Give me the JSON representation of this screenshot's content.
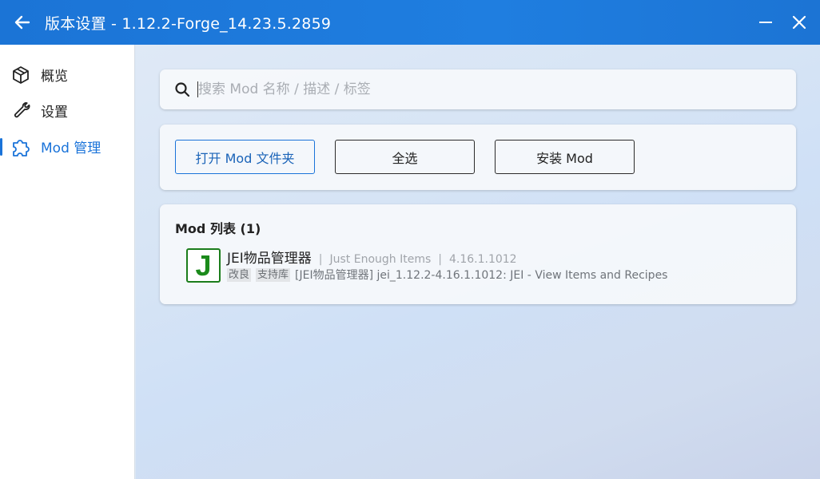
{
  "window": {
    "title": "版本设置 - 1.12.2-Forge_14.23.5.2859",
    "back_icon": "arrow-left-icon",
    "minimize_icon": "minimize-icon",
    "close_icon": "close-icon"
  },
  "sidebar": {
    "items": [
      {
        "label": "概览",
        "icon": "cube-icon",
        "active": false
      },
      {
        "label": "设置",
        "icon": "wrench-icon",
        "active": false
      },
      {
        "label": "Mod 管理",
        "icon": "puzzle-icon",
        "active": true
      }
    ]
  },
  "search": {
    "value": "",
    "placeholder": "搜索 Mod 名称 / 描述 / 标签"
  },
  "actions": {
    "open_folder": "打开 Mod 文件夹",
    "select_all": "全选",
    "install": "安装 Mod"
  },
  "mod_list": {
    "title": "Mod 列表 (1)",
    "items": [
      {
        "name": "JEI物品管理器",
        "english_name": "Just Enough Items",
        "version": "4.16.1.1012",
        "tags": [
          "改良",
          "支持库"
        ],
        "description": "[JEI物品管理器] jei_1.12.2-4.16.1.1012: JEI - View Items and Recipes",
        "icon_letter": "J"
      }
    ]
  },
  "colors": {
    "accent": "#1a73d9",
    "titlebar": "#1f7ee0",
    "jei_green": "#1b8a1b"
  }
}
